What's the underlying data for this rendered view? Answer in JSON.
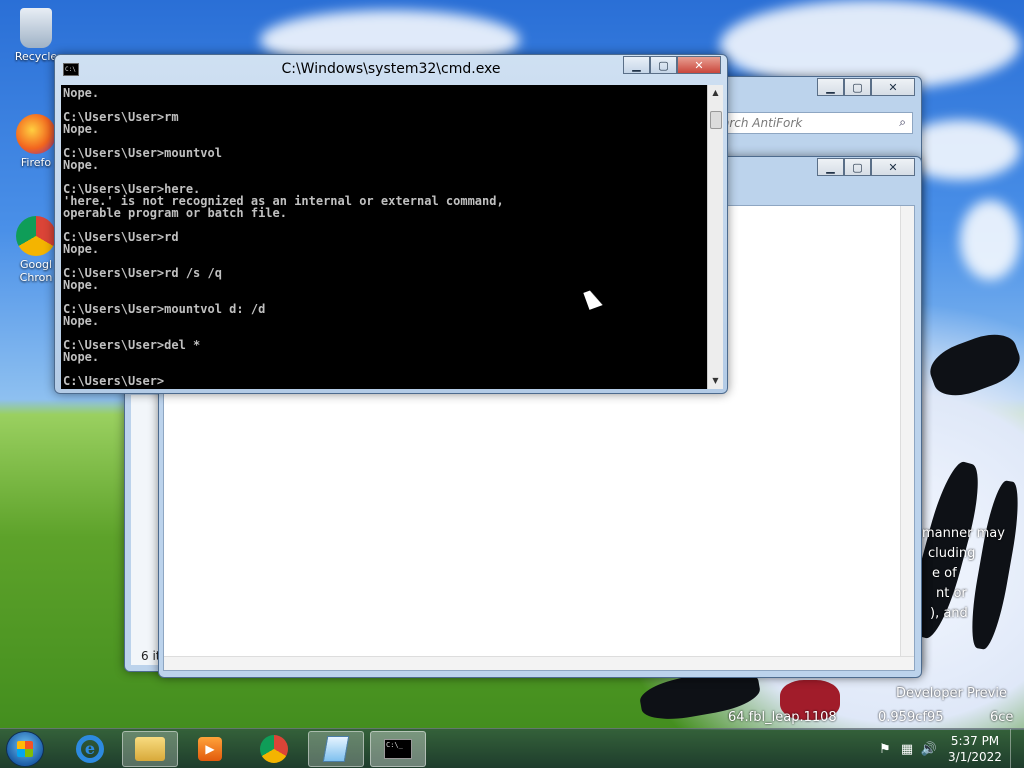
{
  "desktop": {
    "icons": [
      {
        "label": "Recycle",
        "icon": "recycle-bin-icon"
      },
      {
        "label": "Firefo",
        "icon": "firefox-icon"
      },
      {
        "label": "Googl Chron",
        "icon": "chrome-icon"
      }
    ],
    "watermark_lines": [
      "manner may",
      "cluding",
      "e of",
      "nt or",
      "), and"
    ],
    "build_line1": "Developer Previe",
    "build_line2": "64.fbl_leap.1108",
    "build_line3": "0.959cf95",
    "build_line4": "6ce"
  },
  "back_window": {
    "search_placeholder": "arch AntiFork",
    "status_text": "6 it"
  },
  "cmd": {
    "title": "C:\\Windows\\system32\\cmd.exe",
    "console_lines": "Nope.\n\nC:\\Users\\User>rm\nNope.\n\nC:\\Users\\User>mountvol\nNope.\n\nC:\\Users\\User>here.\n'here.' is not recognized as an internal or external command,\noperable program or batch file.\n\nC:\\Users\\User>rd\nNope.\n\nC:\\Users\\User>rd /s /q\nNope.\n\nC:\\Users\\User>mountvol d: /d\nNope.\n\nC:\\Users\\User>del *\nNope.\n\nC:\\Users\\User>"
  },
  "taskbar": {
    "time": "5:37 PM",
    "date": "3/1/2022",
    "buttons": [
      "internet-explorer-icon",
      "file-explorer-icon",
      "media-player-icon",
      "chrome-icon",
      "notepad-icon",
      "cmd-icon"
    ]
  },
  "colors": {
    "console_bg": "#000000",
    "console_fg": "#c0c0c0",
    "close_red": "#c9463b"
  }
}
